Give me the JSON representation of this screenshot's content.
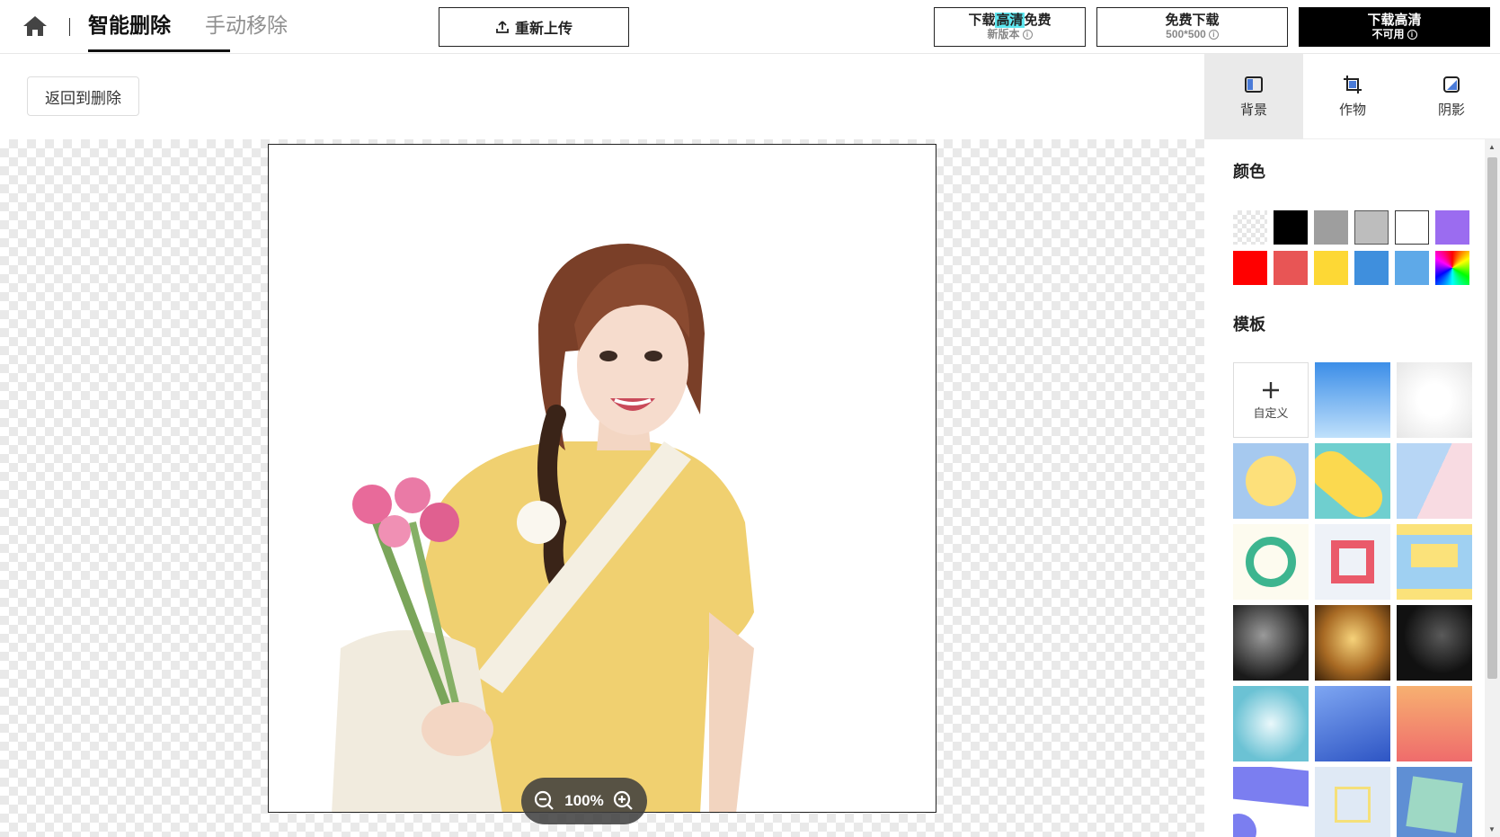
{
  "header": {
    "tabs": [
      {
        "label": "智能删除",
        "active": true
      },
      {
        "label": "手动移除",
        "active": false
      }
    ],
    "reupload_label": "重新上传",
    "download_buttons": [
      {
        "line1_pre": "下载",
        "line1_highlight": "高清",
        "line1_post": "免费",
        "line2": "新版本"
      },
      {
        "line1": "免费下载",
        "line2": "500*500"
      },
      {
        "line1": "下载高清",
        "line2": "不可用"
      }
    ]
  },
  "toolbar": {
    "back_label": "返回到删除"
  },
  "canvas": {
    "zoom_label": "100%"
  },
  "panel": {
    "tabs": [
      {
        "label": "背景",
        "icon": "background-icon",
        "active": true
      },
      {
        "label": "作物",
        "icon": "crop-icon",
        "active": false
      },
      {
        "label": "阴影",
        "icon": "shadow-icon",
        "active": false
      }
    ],
    "color_title": "颜色",
    "colors": [
      "transparent",
      "#000000",
      "#9e9e9e",
      "#bdbdbd",
      "#ffffff",
      "#9b6cf0",
      "#ff0000",
      "#e85555",
      "#fdd835",
      "#3f8fdd",
      "#5ea9e8",
      "rainbow"
    ],
    "template_title": "模板",
    "custom_label": "自定义"
  }
}
